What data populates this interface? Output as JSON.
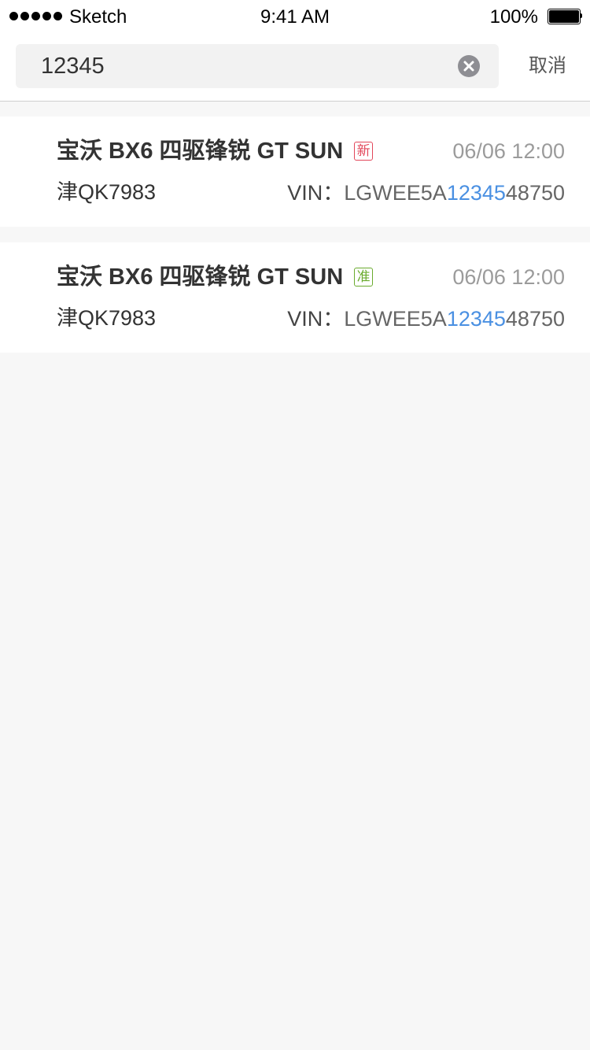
{
  "status_bar": {
    "carrier": "Sketch",
    "time": "9:41 AM",
    "battery": "100%"
  },
  "search": {
    "value": "12345",
    "clear_icon": "clear-circle-icon",
    "cancel_label": "取消"
  },
  "results": [
    {
      "title": "宝沃 BX6 四驱锋锐 GT SUN",
      "tag": "新",
      "tag_color": "#e2475a",
      "time": "06/06 12:00",
      "plate": "津QK7983",
      "vin_label": "VIN：",
      "vin_prefix": "LGWEE5A",
      "vin_match": "12345",
      "vin_suffix": "48750"
    },
    {
      "title": "宝沃 BX6 四驱锋锐 GT SUN",
      "tag": "准",
      "tag_color": "#6aab2e",
      "time": "06/06 12:00",
      "plate": "津QK7983",
      "vin_label": "VIN：",
      "vin_prefix": "LGWEE5A",
      "vin_match": "12345",
      "vin_suffix": "48750"
    }
  ],
  "colors": {
    "highlight": "#4a90e2",
    "background": "#f7f7f7"
  }
}
